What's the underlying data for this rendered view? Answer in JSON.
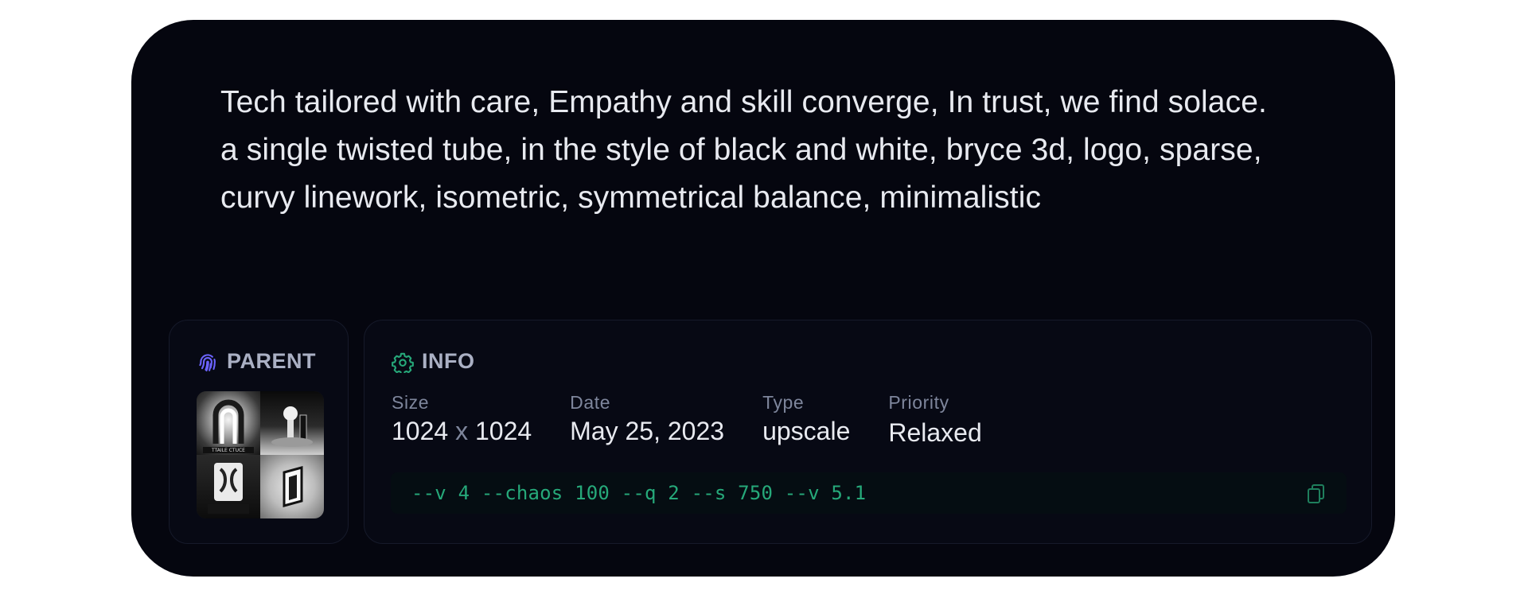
{
  "prompt": {
    "line1": "Tech tailored with care, Empathy and skill converge, In trust, we find solace.",
    "line2": "a single twisted tube, in the style of black and white, bryce 3d, logo, sparse,",
    "line3": "curvy linework, isometric, symmetrical balance, minimalistic"
  },
  "parent": {
    "title": "PARENT",
    "icon": "fingerprint-icon",
    "thumbnail_caption": "TTAILE CTUCE"
  },
  "info": {
    "title": "INFO",
    "icon": "gear-icon",
    "fields": {
      "size_label": "Size",
      "size_w": "1024",
      "size_x": "x",
      "size_h": "1024",
      "date_label": "Date",
      "date_value": "May 25, 2023",
      "type_label": "Type",
      "type_value": "upscale",
      "priority_label": "Priority",
      "priority_value": "Relaxed"
    },
    "command": "--v 4 --chaos 100 --q 2 --s 750 --v 5.1",
    "copy_icon": "copy-icon"
  },
  "colors": {
    "card_bg": "#05060f",
    "accent_green": "#26a97a",
    "accent_purple": "#6b63ff"
  }
}
